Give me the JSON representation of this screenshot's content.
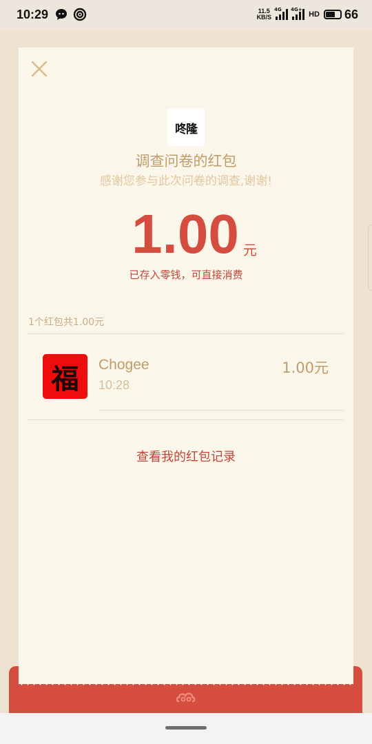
{
  "status_bar": {
    "time": "10:29",
    "net_speed_value": "11.5",
    "net_speed_unit": "KB/S",
    "sim1": "4G",
    "sim2": "4G+",
    "hd": "HD",
    "battery": "66",
    "battery_level": 0.66
  },
  "packet": {
    "logo_text": "咚隆",
    "title": "调查问卷的红包",
    "subtitle": "感谢您参与此次问卷的调查,谢谢!",
    "amount": "1.00",
    "currency": "元",
    "deposit_note": "已存入零钱，可直接消费"
  },
  "summary": "1个红包共1.00元",
  "records": [
    {
      "name": "Chogee",
      "time": "10:28",
      "amount": "1.00元",
      "avatar_glyph": "福"
    }
  ],
  "history_link": "查看我的红包记录",
  "colors": {
    "accent_red": "#d44d3f",
    "gold_text": "#bf9d6b",
    "card_bg": "#fbf6ea",
    "page_bg": "#ede3d0"
  },
  "icons": [
    "close-icon",
    "cloud-icon",
    "wechat-icon",
    "hotspot-icon",
    "signal-icon",
    "battery-icon"
  ]
}
